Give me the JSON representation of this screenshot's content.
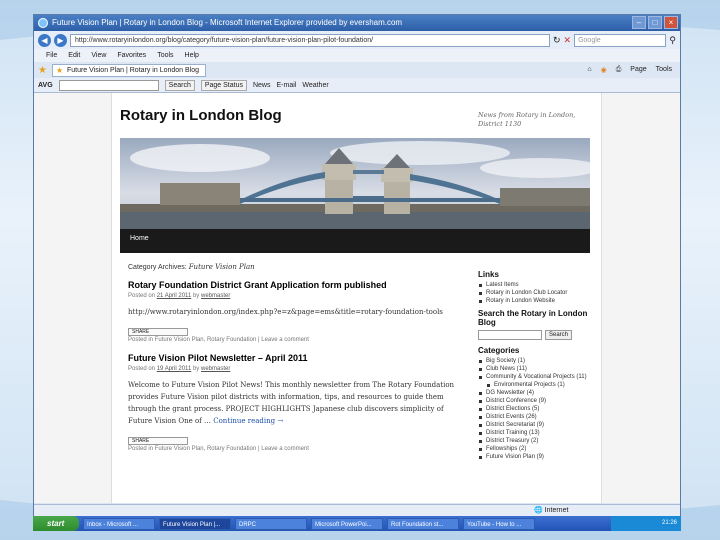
{
  "window": {
    "title": "Future Vision Plan | Rotary in London Blog - Microsoft Internet Explorer provided by eversham.com",
    "url": "http://www.rotaryinlondon.org/blog/category/future-vision-plan/future-vision-plan-pilot-foundation/",
    "search_placeholder": "Google"
  },
  "menu": [
    "File",
    "Edit",
    "View",
    "Favorites",
    "Tools",
    "Help"
  ],
  "tab": {
    "label": "Future Vision Plan | Rotary in London Blog"
  },
  "commands": [
    "Page",
    "Tools"
  ],
  "toolbar2": {
    "brand": "AVG",
    "search_btn": "Search",
    "page_status": "Page Status",
    "news": "News",
    "email": "E-mail",
    "weather": "Weather"
  },
  "blog": {
    "title": "Rotary in London Blog",
    "description": "News from Rotary in London, District 1130",
    "nav_home": "Home",
    "category_label": "Category Archives:",
    "category_name": "Future Vision Plan",
    "posts": [
      {
        "title": "Rotary Foundation District Grant Application form published",
        "meta_prefix": "Posted on",
        "date": "21 April 2011",
        "meta_by": "by",
        "author": "webmaster",
        "body": "http://www.rotaryinlondon.org/index.php?e=z&page=ems&title=rotary-foundation-tools",
        "share": "SHARE",
        "posted_in_prefix": "Posted in",
        "posted_in": "Future Vision Plan, Rotary Foundation",
        "comment": "Leave a comment"
      },
      {
        "title": "Future Vision Pilot Newsletter – April 2011",
        "meta_prefix": "Posted on",
        "date": "19 April 2011",
        "meta_by": "by",
        "author": "webmaster",
        "body": "Welcome to Future Vision Pilot News! This monthly newsletter from The Rotary Foundation provides Future Vision pilot districts with information, tips, and resources to guide them through the grant process. PROJECT HIGHLIGHTS Japanese club discovers simplicity of Future Vision One of …",
        "continue": "Continue reading →",
        "share": "SHARE",
        "posted_in_prefix": "Posted in",
        "posted_in": "Future Vision Plan, Rotary Foundation",
        "comment": "Leave a comment"
      }
    ],
    "sidebar": {
      "links_title": "Links",
      "links": [
        "Latest Items",
        "Rotary in London Club Locator",
        "Rotary in London Website"
      ],
      "search_title": "Search the Rotary in London Blog",
      "search_btn": "Search",
      "categories_title": "Categories",
      "categories": [
        {
          "label": "Big Society (1)",
          "sub": false
        },
        {
          "label": "Club News (11)",
          "sub": false
        },
        {
          "label": "Community & Vocational Projects (11)",
          "sub": false
        },
        {
          "label": "Environmental Projects (1)",
          "sub": true
        },
        {
          "label": "DG Newsletter (4)",
          "sub": false
        },
        {
          "label": "District Conference (9)",
          "sub": false
        },
        {
          "label": "District Elections (5)",
          "sub": false
        },
        {
          "label": "District Events (26)",
          "sub": false
        },
        {
          "label": "District Secretariat (9)",
          "sub": false
        },
        {
          "label": "District Training (13)",
          "sub": false
        },
        {
          "label": "District Treasury (2)",
          "sub": false
        },
        {
          "label": "Fellowships (2)",
          "sub": false
        },
        {
          "label": "Future Vision Plan (9)",
          "sub": false
        }
      ]
    }
  },
  "status": {
    "zone": "Internet"
  },
  "taskbar": {
    "start": "start",
    "tasks": [
      "Inbox - Microsoft ...",
      "Future Vision Plan |...",
      "DRPC",
      "Microsoft PowerPoi...",
      "Rot Foundation st...",
      "YouTube - How to ..."
    ],
    "clock": "21:26"
  }
}
